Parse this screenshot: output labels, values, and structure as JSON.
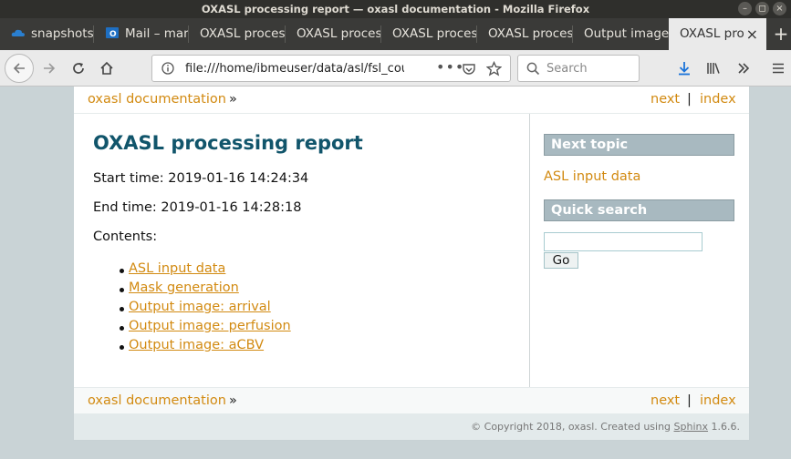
{
  "window": {
    "title": "OXASL processing report — oxasl documentation - Mozilla Firefox"
  },
  "tabs": [
    {
      "label": "snapshots"
    },
    {
      "label": "Mail – mar"
    },
    {
      "label": "OXASL proces"
    },
    {
      "label": "OXASL proces"
    },
    {
      "label": "OXASL proces"
    },
    {
      "label": "OXASL proces"
    },
    {
      "label": "Output image"
    },
    {
      "label": "OXASL pro"
    }
  ],
  "navbar": {
    "url": "file:///home/ibmeuser/data/asl/fsl_cours",
    "search_placeholder": "Search"
  },
  "relbar": {
    "home": "oxasl documentation",
    "raquo": "»",
    "next": "next",
    "sep": "|",
    "index": "index"
  },
  "main": {
    "title": "OXASL processing report",
    "start_time": "Start time: 2019-01-16 14:24:34",
    "end_time": "End time: 2019-01-16 14:28:18",
    "contents_label": "Contents:",
    "toc": [
      "ASL input data",
      "Mask generation",
      "Output image: arrival",
      "Output image: perfusion",
      "Output image: aCBV"
    ]
  },
  "sidebar": {
    "next_topic_heading": "Next topic",
    "next_topic_link": "ASL input data",
    "quick_search_heading": "Quick search",
    "go_label": "Go"
  },
  "footer": {
    "copyright": "© Copyright 2018, oxasl. Created using ",
    "sphinx": "Sphinx",
    "version": " 1.6.6."
  },
  "colors": {
    "link": "#d28a11",
    "heading": "#11556b",
    "sidebar_heading_bg": "#a8b9c0",
    "footer_bg": "#e3eaeb"
  }
}
